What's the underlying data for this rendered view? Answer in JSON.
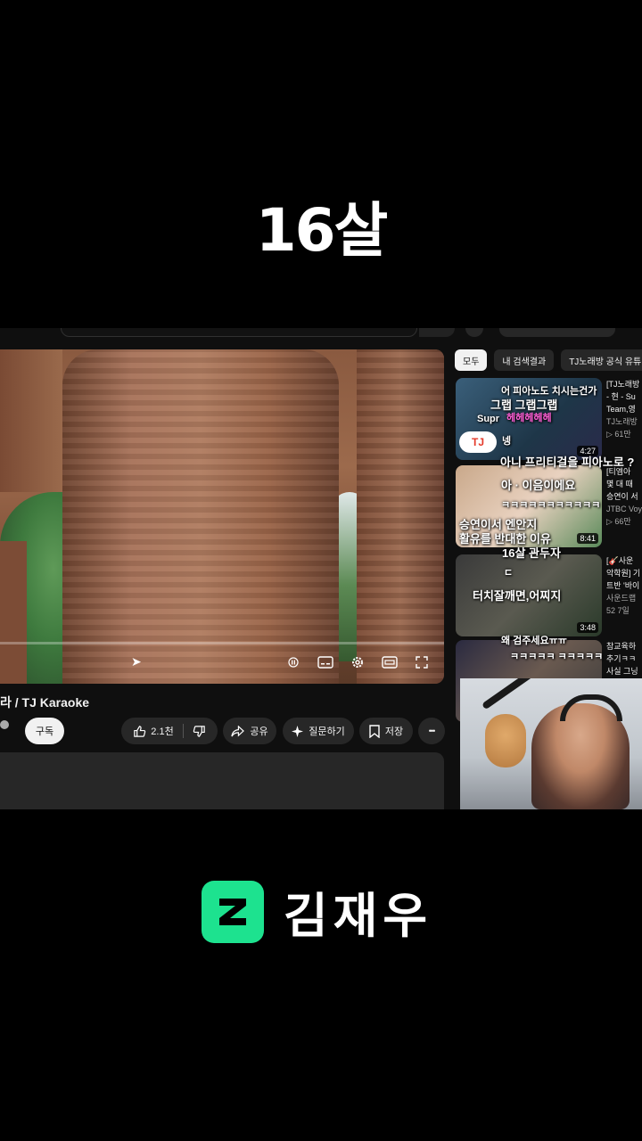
{
  "overlay": {
    "title": "16살"
  },
  "video": {
    "title": "라 / TJ Karaoke",
    "subscribe_label": "구독",
    "like_count": "2.1천",
    "share_label": "공유",
    "ask_label": "질문하기",
    "save_label": "저장",
    "more_label": "•••"
  },
  "sidebar": {
    "chips": [
      "모두",
      "내 검색결과",
      "TJ노래방 공식 유튜"
    ],
    "items": [
      {
        "duration": "4:27",
        "badge": "TJ",
        "meta": [
          "[TJ노래방",
          "- 현 - Su",
          "Team,영",
          "TJ노래방",
          "▷ 61만"
        ]
      },
      {
        "duration": "8:41",
        "meta": [
          "[티엠아",
          "몇 대 때",
          "승연이 서",
          "JTBC Voy",
          "▷ 66만"
        ]
      },
      {
        "duration": "3:48",
        "meta": [
          "[🎸사운",
          "악학원] 기",
          "트반 '바이",
          "사운드랩",
          "52 7일"
        ]
      },
      {
        "duration": "",
        "meta": [
          "참교육하",
          "추기ㅋㅋ",
          "사실 그닝"
        ]
      }
    ]
  },
  "captions": {
    "c1": "어 피아노도 치시는건가",
    "c2": "그랩 그랩그랩",
    "c3": "Supr",
    "c4": "헤헤헤헤헤",
    "c5": "넹",
    "c6": "아니 프리티걸을 피아노로 ?",
    "c7": "아 · 이음이에요",
    "c8": "ㅋㅋㅋㅋㅋㅋㅋㅋㅋㅋㅋ",
    "c9": "승연이서 엔안지",
    "c10": "활유를 반대한 이유",
    "c11": "16살 관두자",
    "c12": "ㄷ",
    "c13": "터치잘깨면,어찌지",
    "c14": "왜 검주세요ㅠㅠ",
    "c15": "ㅋㅋㅋㅋㅋ ㅋㅋㅋㅋㅋ"
  },
  "brand": {
    "name": "김재우"
  },
  "colors": {
    "accent": "#1de28f",
    "background": "#000000",
    "panel": "#0f0f0f"
  }
}
